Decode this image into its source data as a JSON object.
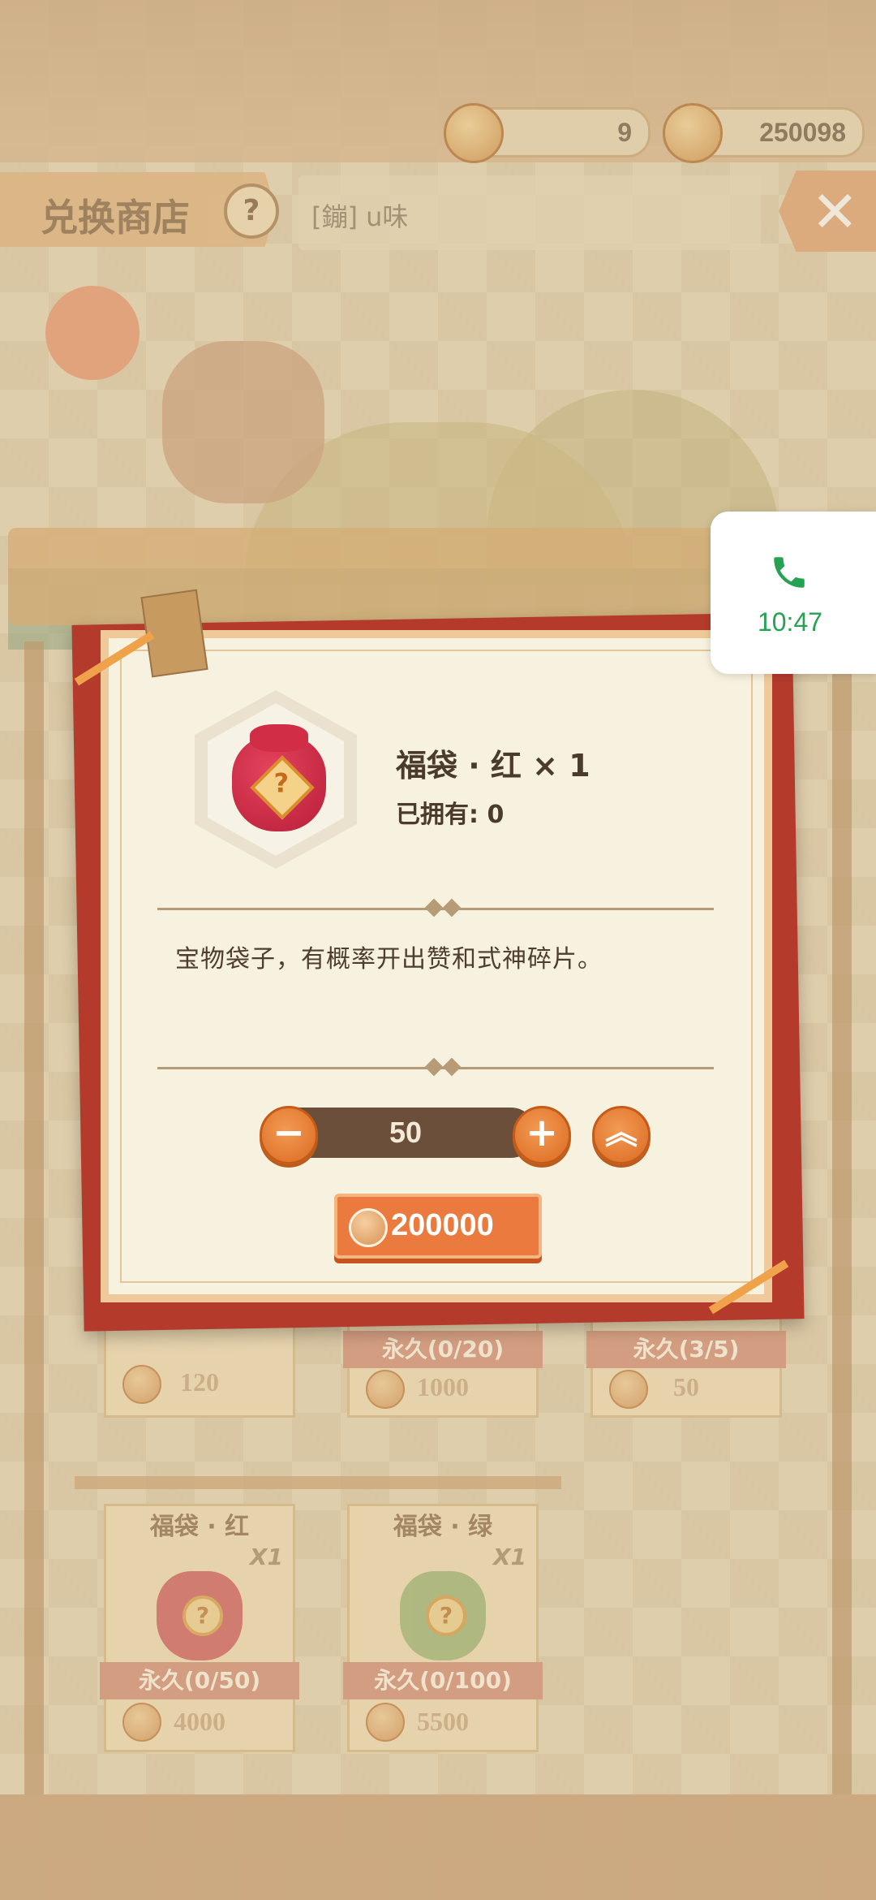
{
  "topbar": {
    "currency_1": "9",
    "currency_2": "250098"
  },
  "shop": {
    "title": "兑换商店",
    "help_glyph": "?",
    "announcement": "[鏰] u味",
    "close_glyph": "✕"
  },
  "cards_row1": [
    {
      "price": "120"
    },
    {
      "limit": "永久(0/20)",
      "price": "1000"
    },
    {
      "limit": "永久(3/5)",
      "price": "50"
    }
  ],
  "cards_row2": [
    {
      "name": "福袋 · 红",
      "qty": "X1",
      "limit": "永久(0/50)",
      "price": "4000",
      "color": "#c83a45"
    },
    {
      "name": "福袋 · 绿",
      "qty": "X1",
      "limit": "永久(0/100)",
      "price": "5500",
      "color": "#8fb06a"
    }
  ],
  "modal": {
    "item_name": "福袋 · 红 × 1",
    "owned": "已拥有: 0",
    "description": "宝物袋子，有概率开出赞和式神碎片。",
    "quantity": "50",
    "minus_glyph": "−",
    "plus_glyph": "+",
    "max_glyph": "︽",
    "price": "200000",
    "question_glyph": "?"
  },
  "call_widget": {
    "time": "10:47",
    "icon": "phone-icon",
    "color": "#26a352"
  }
}
